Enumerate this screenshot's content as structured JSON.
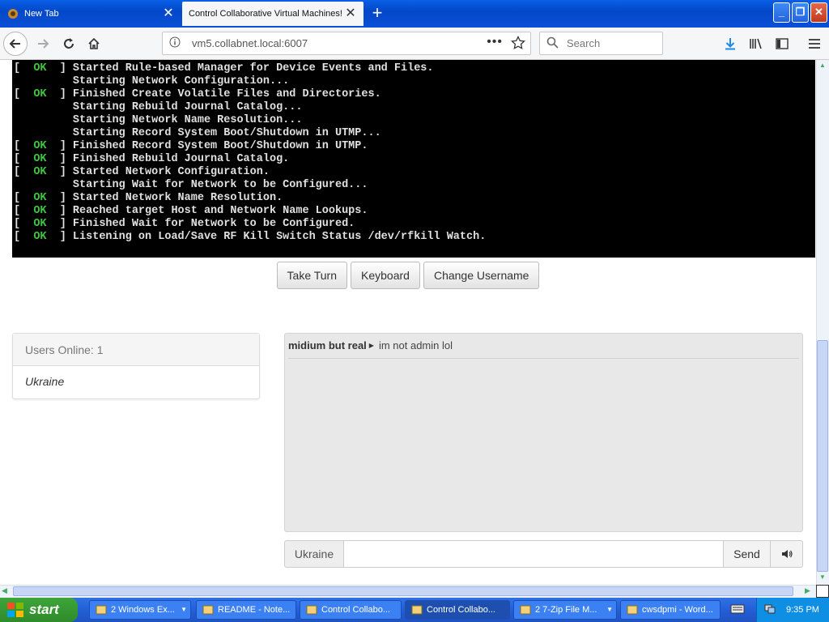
{
  "browser": {
    "tabs": [
      {
        "title": "New Tab",
        "active": false
      },
      {
        "title": "Control Collaborative Virtual Machines!",
        "active": true
      }
    ],
    "url": "vm5.collabnet.local:6007",
    "search_placeholder": "Search"
  },
  "terminal": {
    "lines": [
      {
        "status": "OK",
        "text": "Started Rule-based Manager for Device Events and Files."
      },
      {
        "status": "",
        "text": "Starting Network Configuration..."
      },
      {
        "status": "OK",
        "text": "Finished Create Volatile Files and Directories."
      },
      {
        "status": "",
        "text": "Starting Rebuild Journal Catalog..."
      },
      {
        "status": "",
        "text": "Starting Network Name Resolution..."
      },
      {
        "status": "",
        "text": "Starting Record System Boot/Shutdown in UTMP..."
      },
      {
        "status": "OK",
        "text": "Finished Record System Boot/Shutdown in UTMP."
      },
      {
        "status": "OK",
        "text": "Finished Rebuild Journal Catalog."
      },
      {
        "status": "OK",
        "text": "Started Network Configuration."
      },
      {
        "status": "",
        "text": "Starting Wait for Network to be Configured..."
      },
      {
        "status": "OK",
        "text": "Started Network Name Resolution."
      },
      {
        "status": "OK",
        "text": "Reached target Host and Network Name Lookups."
      },
      {
        "status": "OK",
        "text": "Finished Wait for Network to be Configured."
      },
      {
        "status": "OK",
        "text": "Listening on Load/Save RF Kill Switch Status /dev/rfkill Watch."
      }
    ]
  },
  "controls": {
    "take_turn": "Take Turn",
    "keyboard": "Keyboard",
    "change_username": "Change Username"
  },
  "users": {
    "heading": "Users Online: 1",
    "list": [
      "Ukraine"
    ]
  },
  "chat": {
    "messages": [
      {
        "user": "midium but real",
        "text": "im not admin lol"
      }
    ],
    "username_addon": "Ukraine",
    "input_value": "",
    "send_label": "Send"
  },
  "taskbar": {
    "start_label": "start",
    "items": [
      {
        "label": "2 Windows Ex...",
        "active": false,
        "caret": true
      },
      {
        "label": "README - Note...",
        "active": false,
        "caret": false
      },
      {
        "label": "Control Collabo...",
        "active": false,
        "caret": false
      },
      {
        "label": "Control Collabo...",
        "active": true,
        "caret": false
      },
      {
        "label": "2 7-Zip File M...",
        "active": false,
        "caret": true
      },
      {
        "label": "cwsdpmi - Word...",
        "active": false,
        "caret": false
      }
    ],
    "clock": "9:35 PM"
  },
  "colors": {
    "terminal_ok": "#3ec43e",
    "titlebar": "#0a4fd6",
    "taskbar": "#245fd6",
    "start_button": "#3ea53a"
  }
}
